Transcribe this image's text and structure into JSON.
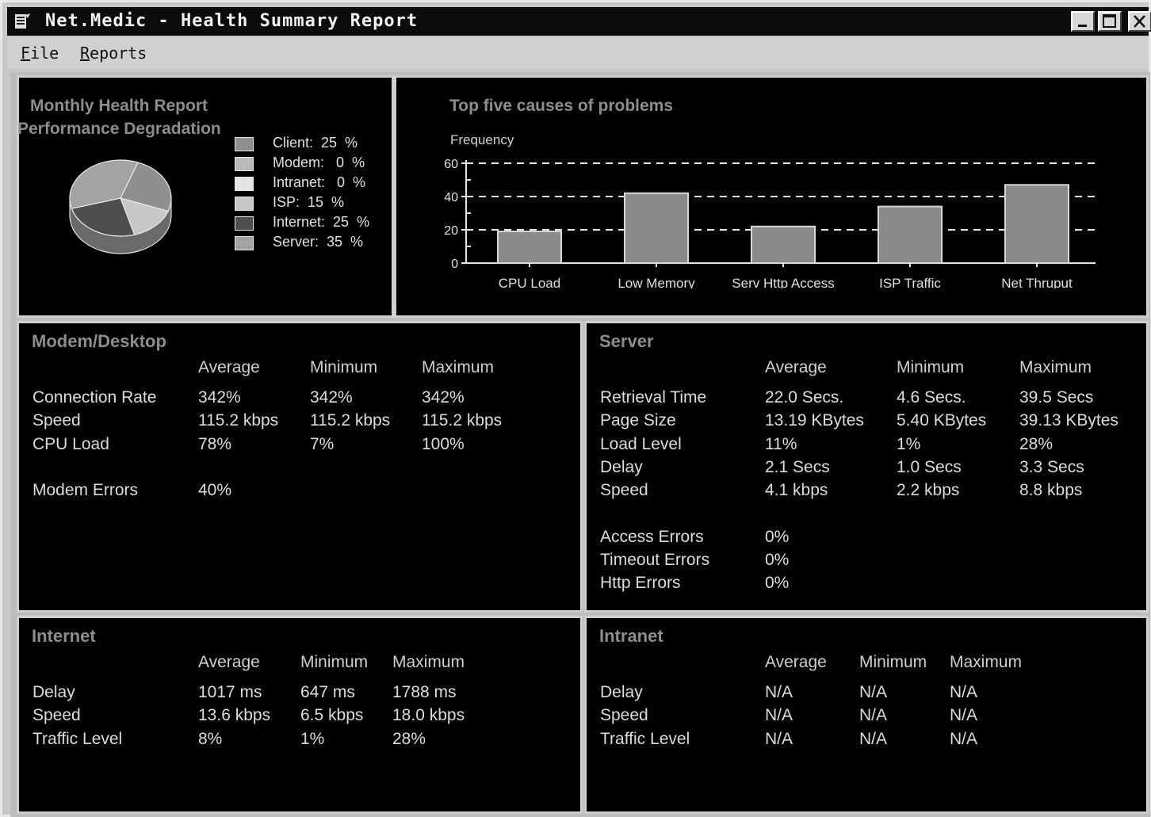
{
  "window": {
    "title": "Net.Medic - Health Summary Report"
  },
  "menu": {
    "file": {
      "mnemonic": "F",
      "rest": "ile"
    },
    "reports": {
      "mnemonic": "R",
      "rest": "eports"
    }
  },
  "health_panel": {
    "title_line1": "Monthly Health Report",
    "title_line2": "Performance Degradation",
    "legend": [
      {
        "label": "Client:  25  %",
        "color": "#8f8f8f"
      },
      {
        "label": "Modem:   0  %",
        "color": "#b9b9b9"
      },
      {
        "label": "Intranet:   0  %",
        "color": "#e4e4e4"
      },
      {
        "label": "ISP:  15  %",
        "color": "#c7c7c7"
      },
      {
        "label": "Internet:  25  %",
        "color": "#4e4e4e"
      },
      {
        "label": "Server:  35  %",
        "color": "#a3a3a3"
      }
    ]
  },
  "causes_panel": {
    "title": "Top five causes of problems"
  },
  "chart_data": [
    {
      "type": "pie",
      "title": "Monthly Health Report Performance Degradation",
      "categories": [
        "Client",
        "Modem",
        "Intranet",
        "ISP",
        "Internet",
        "Server"
      ],
      "values": [
        25,
        0,
        0,
        15,
        25,
        35
      ],
      "colors": [
        "#8f8f8f",
        "#b9b9b9",
        "#e4e4e4",
        "#c7c7c7",
        "#4e4e4e",
        "#a3a3a3"
      ],
      "legend": "right",
      "style": "3d"
    },
    {
      "type": "bar",
      "title": "Top five causes of problems",
      "ylabel": "Frequency",
      "xlabel": "",
      "categories": [
        "CPU Load",
        "Low Memory",
        "Serv Http Access",
        "ISP Traffic",
        "Net Thruput"
      ],
      "values": [
        19,
        42,
        22,
        34,
        47
      ],
      "ylim": [
        0,
        60
      ],
      "yticks": [
        0,
        20,
        40,
        60
      ],
      "grid": true,
      "bar_color": "#8a8a8a"
    }
  ],
  "modem_desktop": {
    "title": "Modem/Desktop",
    "headers": [
      "Average",
      "Minimum",
      "Maximum"
    ],
    "rows": [
      {
        "label": "Connection Rate",
        "values": [
          "342%",
          "342%",
          "342%"
        ]
      },
      {
        "label": "Speed",
        "values": [
          "115.2 kbps",
          "115.2 kbps",
          "115.2 kbps"
        ]
      },
      {
        "label": "CPU Load",
        "values": [
          "78%",
          "7%",
          "100%"
        ]
      }
    ],
    "errors": [
      {
        "label": "Modem Errors",
        "value": "40%"
      }
    ]
  },
  "server": {
    "title": "Server",
    "headers": [
      "Average",
      "Minimum",
      "Maximum"
    ],
    "rows": [
      {
        "label": "Retrieval Time",
        "values": [
          "22.0 Secs.",
          "4.6 Secs.",
          "39.5 Secs"
        ]
      },
      {
        "label": "Page Size",
        "values": [
          "13.19 KBytes",
          "5.40 KBytes",
          "39.13 KBytes"
        ]
      },
      {
        "label": "Load Level",
        "values": [
          "11%",
          "1%",
          "28%"
        ]
      },
      {
        "label": "Delay",
        "values": [
          "2.1 Secs",
          "1.0 Secs",
          "3.3 Secs"
        ]
      },
      {
        "label": "Speed",
        "values": [
          "4.1 kbps",
          "2.2 kbps",
          "8.8 kbps"
        ]
      }
    ],
    "errors": [
      {
        "label": "Access Errors",
        "value": "0%"
      },
      {
        "label": "Timeout Errors",
        "value": "0%"
      },
      {
        "label": "Http Errors",
        "value": "0%"
      }
    ]
  },
  "internet": {
    "title": "Internet",
    "headers": [
      "Average",
      "Minimum",
      "Maximum"
    ],
    "rows": [
      {
        "label": "Delay",
        "values": [
          "1017 ms",
          "647 ms",
          "1788 ms"
        ]
      },
      {
        "label": "Speed",
        "values": [
          "13.6 kbps",
          "6.5 kbps",
          "18.0 kbps"
        ]
      },
      {
        "label": "Traffic Level",
        "values": [
          "8%",
          "1%",
          "28%"
        ]
      }
    ]
  },
  "intranet": {
    "title": "Intranet",
    "headers": [
      "Average",
      "Minimum",
      "Maximum"
    ],
    "rows": [
      {
        "label": "Delay",
        "values": [
          "N/A",
          "N/A",
          "N/A"
        ]
      },
      {
        "label": "Speed",
        "values": [
          "N/A",
          "N/A",
          "N/A"
        ]
      },
      {
        "label": "Traffic Level",
        "values": [
          "N/A",
          "N/A",
          "N/A"
        ]
      }
    ]
  },
  "colors": {
    "panel_bg": "#000000",
    "title_gray": "#8d8d8d",
    "text": "#dcdcdc"
  },
  "icons": [
    "app-icon",
    "minimize-icon",
    "maximize-icon",
    "close-icon"
  ]
}
